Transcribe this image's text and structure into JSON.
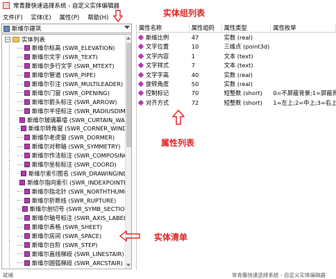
{
  "window": {
    "title": "常青藤快速选择系统 - 自定义实体编辑器"
  },
  "menu": {
    "items": [
      "文件(F)",
      "实体(E)",
      "属性(P)",
      "帮助(H)"
    ]
  },
  "combo": {
    "value": "斯维尔建筑"
  },
  "tree": {
    "root_label": "实体列表",
    "items": [
      "斯维尔标高 (SWR_ELEVATION)",
      "斯维尔文字 (SWR_TEXT)",
      "斯维尔多行文字 (SWR_MTEXT)",
      "斯维尔管道 (SWR_PIPE)",
      "斯维尔引注 (SWR_MULTILEADER)",
      "斯维尔门窗 (SWR_OPENING)",
      "斯维尔箭头标注 (SWR_ARROW)",
      "斯维尔半径标注 (SWR_RADIUSDIM)",
      "斯维尔玻璃幕墙 (SWR_CURTAIN_WALL",
      "斯维尔转角窗 (SWR_CORNER_WINDO",
      "斯维尔老虎窗 (SWR_DORMER)",
      "斯维尔对称轴 (SWR_SYMMETRY)",
      "斯维尔作法标注 (SWR_COMPOSING)",
      "斯维尔坐标标注 (SWR_COORD)",
      "斯维尔索引图名 (SWR_DRAWINGINDE",
      "斯维尔指向索引 (SWR_INDEXPOINTER",
      "斯维尔指北针 (SWR_NORTHTHUMB)",
      "斯维尔折断线 (SWR_RUPTURE)",
      "斯维尔剖切号 (SWR_SYMB_SECTION)",
      "斯维尔轴号标注 (SWR_AXIS_LABEL)",
      "斯维尔表格 (SWR_SHEET)",
      "斯维尔房间 (SWR_SPACE)",
      "斯维尔台阶 (SWR_STEP)",
      "斯维尔直线梯段 (SWR_LINESTAIR)",
      "斯维尔圆弧梯段 (SWR_ARCSTAIR)"
    ]
  },
  "grid": {
    "headers": [
      "属性名称",
      "属性组码",
      "属性类型",
      "属性枚举"
    ],
    "rows": [
      [
        "斯维比例",
        "47",
        "实数 (real)",
        ""
      ],
      [
        "文字位置",
        "10",
        "三维点 (point3d)",
        ""
      ],
      [
        "文字内容",
        "1",
        "文本 (text)",
        ""
      ],
      [
        "文字样式",
        "7",
        "文本 (text)",
        ""
      ],
      [
        "文字字高",
        "40",
        "实数 (real)",
        ""
      ],
      [
        "旋转角度",
        "50",
        "实数 (real)",
        ""
      ],
      [
        "控制标记",
        "70",
        "短整数 (short)",
        "0=不屏蔽背景;1=屏蔽背景"
      ],
      [
        "对齐方式",
        "72",
        "短整数 (short)",
        "1=左上;2=中上;3=右上;4="
      ]
    ]
  },
  "annotations": {
    "group_list": "实体组列表",
    "property_list": "属性列表",
    "entity_list": "实体清单"
  },
  "status": {
    "left": "就绪",
    "right": "常青藤快速选择系统 - 自定义实体编辑器"
  },
  "colors": {
    "annotation": "#e02020",
    "entity_icon": "#b33ab3"
  }
}
